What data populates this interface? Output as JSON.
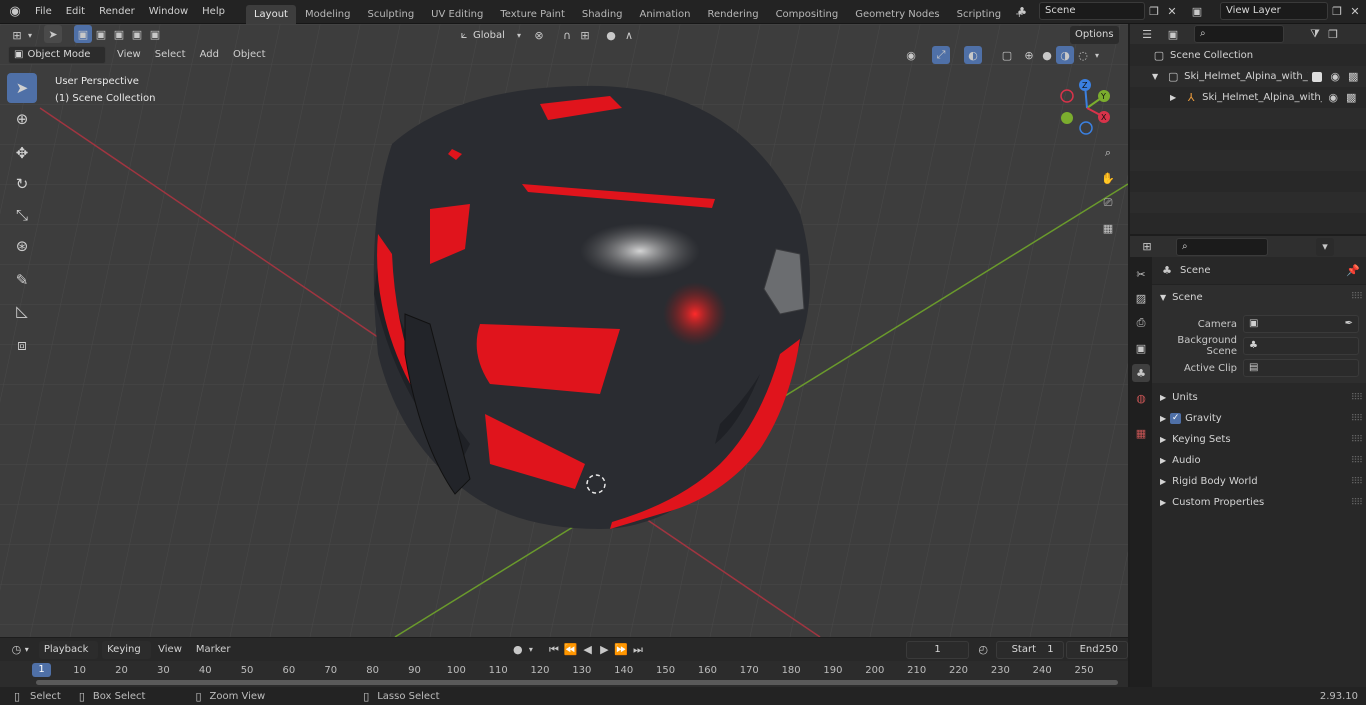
{
  "app": {
    "version": "2.93.10"
  },
  "menu": {
    "items": [
      "File",
      "Edit",
      "Render",
      "Window",
      "Help"
    ]
  },
  "workspaces": {
    "tabs": [
      "Layout",
      "Modeling",
      "Sculpting",
      "UV Editing",
      "Texture Paint",
      "Shading",
      "Animation",
      "Rendering",
      "Compositing",
      "Geometry Nodes",
      "Scripting"
    ],
    "active": "Layout",
    "add": "+"
  },
  "scene_selector": {
    "value": "Scene"
  },
  "viewlayer_selector": {
    "value": "View Layer"
  },
  "viewport": {
    "mode": "Object Mode",
    "menus": [
      "View",
      "Select",
      "Add",
      "Object"
    ],
    "transform_orientation": "Global",
    "options_label": "Options",
    "overlay_title": "User Perspective",
    "overlay_subtitle": "(1) Scene Collection",
    "gizmo": {
      "x": "X",
      "y": "Y",
      "z": "Z"
    }
  },
  "outliner": {
    "root": "Scene Collection",
    "items": [
      {
        "name": "Ski_Helmet_Alpina_with_Viso",
        "level": 1
      },
      {
        "name": "Ski_Helmet_Alpina_with_",
        "level": 2
      }
    ]
  },
  "properties": {
    "context_title": "Scene",
    "panel_title": "Scene",
    "fields": [
      {
        "label": "Camera",
        "value": ""
      },
      {
        "label": "Background Scene",
        "value": ""
      },
      {
        "label": "Active Clip",
        "value": ""
      }
    ],
    "sections": [
      "Units",
      "Gravity",
      "Keying Sets",
      "Audio",
      "Rigid Body World",
      "Custom Properties"
    ],
    "gravity_checked": true
  },
  "timeline": {
    "menus": [
      "Playback",
      "Keying",
      "View",
      "Marker"
    ],
    "current_frame": "1",
    "start_label": "Start",
    "start_value": "1",
    "end_label": "End",
    "end_value": "250",
    "ruler_current": "1",
    "ruler_ticks": [
      "10",
      "20",
      "30",
      "40",
      "50",
      "60",
      "70",
      "80",
      "90",
      "100",
      "110",
      "120",
      "130",
      "140",
      "150",
      "160",
      "170",
      "180",
      "190",
      "200",
      "210",
      "220",
      "230",
      "240",
      "250"
    ]
  },
  "statusbar": {
    "select": "Select",
    "box_select": "Box Select",
    "zoom_view": "Zoom View",
    "lasso_select": "Lasso Select"
  },
  "colors": {
    "accent": "#4f70a7",
    "active_tab": "#3d3d3d",
    "helmet_red": "#e0141c",
    "helmet_body": "#2a2c31"
  }
}
